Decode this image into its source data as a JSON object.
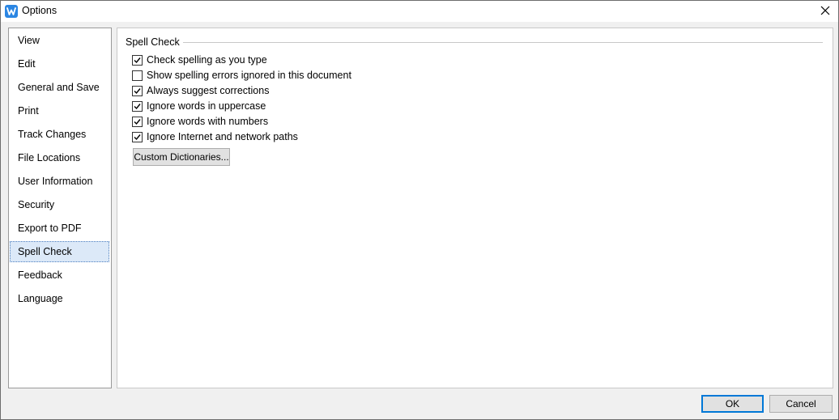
{
  "window": {
    "title": "Options"
  },
  "icons": {
    "app": "wps-writer-icon",
    "close": "close-icon",
    "check": "checkmark-icon"
  },
  "sidebar": {
    "items": [
      {
        "label": "View",
        "selected": false
      },
      {
        "label": "Edit",
        "selected": false
      },
      {
        "label": "General and Save",
        "selected": false
      },
      {
        "label": "Print",
        "selected": false
      },
      {
        "label": "Track Changes",
        "selected": false
      },
      {
        "label": "File Locations",
        "selected": false
      },
      {
        "label": "User Information",
        "selected": false
      },
      {
        "label": "Security",
        "selected": false
      },
      {
        "label": "Export to PDF",
        "selected": false
      },
      {
        "label": "Spell Check",
        "selected": true
      },
      {
        "label": "Feedback",
        "selected": false
      },
      {
        "label": "Language",
        "selected": false
      }
    ]
  },
  "spell_check": {
    "group_title": "Spell Check",
    "options": [
      {
        "label": "Check spelling as you type",
        "checked": true
      },
      {
        "label": "Show spelling errors ignored in this document",
        "checked": false
      },
      {
        "label": "Always suggest corrections",
        "checked": true
      },
      {
        "label": "Ignore words in uppercase",
        "checked": true
      },
      {
        "label": "Ignore words with numbers",
        "checked": true
      },
      {
        "label": "Ignore Internet and network paths",
        "checked": true
      }
    ],
    "custom_dictionaries_label": "Custom Dictionaries..."
  },
  "footer": {
    "ok_label": "OK",
    "cancel_label": "Cancel"
  },
  "colors": {
    "accent": "#0078d7",
    "selection": "#dce9f8",
    "app_icon": "#2b86e3"
  }
}
